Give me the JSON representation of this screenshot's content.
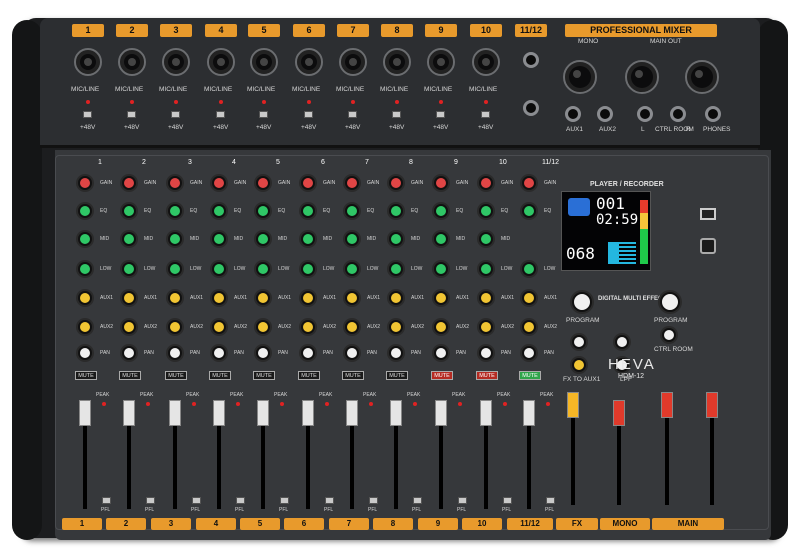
{
  "product": {
    "brand": "HEVA",
    "model": "HDM-12",
    "header": "PROFESSIONAL MIXER",
    "player": "PLAYER / RECORDER",
    "effects": "DIGITAL MULTI EFFECTS"
  },
  "top_channels": [
    "1",
    "2",
    "3",
    "4",
    "5",
    "6",
    "7",
    "8",
    "9",
    "10",
    "11/12"
  ],
  "input_label": "MIC/LINE",
  "phantom_label": "+48V",
  "outputs": {
    "mono": "MONO",
    "main_out": "MAIN OUT",
    "aux1": "AUX1",
    "aux2": "AUX2",
    "ctrl_room": "CTRL ROOM",
    "phones": "PHONES",
    "l": "L",
    "r": "R"
  },
  "knob_labels": [
    "GAIN",
    "EQ",
    "MID",
    "LOW",
    "AUX1",
    "AUX2",
    "PAN"
  ],
  "strip_button": "MUTE",
  "peak_label": "PEAK",
  "pfl_label": "PFL",
  "bottom_labels": [
    "1",
    "2",
    "3",
    "4",
    "5",
    "6",
    "7",
    "8",
    "9",
    "10",
    "11/12",
    "FX",
    "MONO",
    "MAIN"
  ],
  "display": {
    "track": "001",
    "time": "02:59",
    "preset": "068"
  },
  "master_labels": {
    "program": "PROGRAM",
    "fx_to_aux": "FX TO AUX1",
    "ctrl_room": "CTRL ROOM",
    "lpf": "LPF"
  },
  "colors": {
    "accent": "#e89a2c",
    "panel": "#36383b",
    "knob_red": "#e04545",
    "knob_green": "#2fc766",
    "knob_yellow": "#f1c533"
  }
}
